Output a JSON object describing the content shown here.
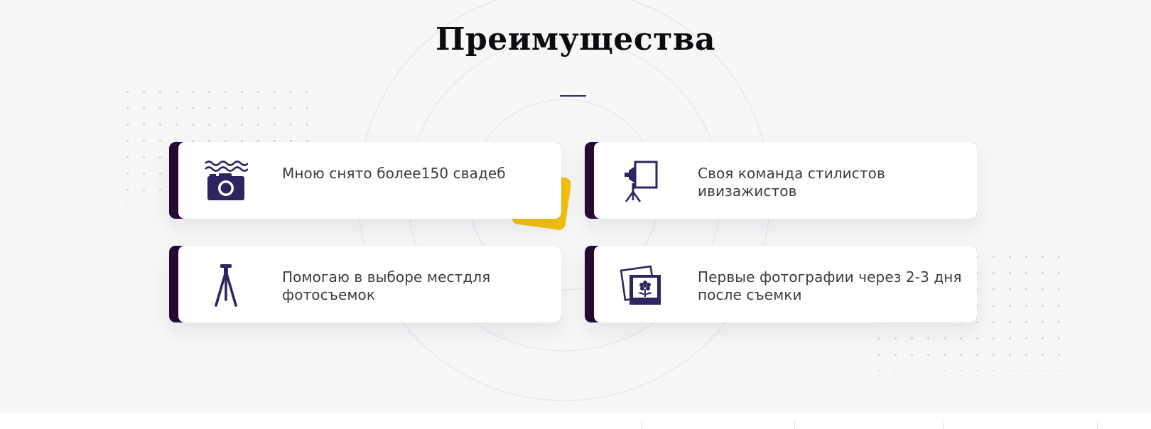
{
  "section": {
    "title": "Преимущества"
  },
  "colors": {
    "accent": "#250a34",
    "icon": "#2e2560",
    "highlight": "#f4c20d",
    "background": "#f7f7f8"
  },
  "advantages": [
    {
      "icon": "camera-icon",
      "text": "Мною снято более150 свадеб"
    },
    {
      "icon": "studio-light-icon",
      "text": "Своя команда стилистов ивизажистов"
    },
    {
      "icon": "tripod-icon",
      "text": "Помогаю в выборе местдля фотосъемок"
    },
    {
      "icon": "photos-icon",
      "text": "Первые фотографии через 2-3 дня после съемки"
    }
  ]
}
